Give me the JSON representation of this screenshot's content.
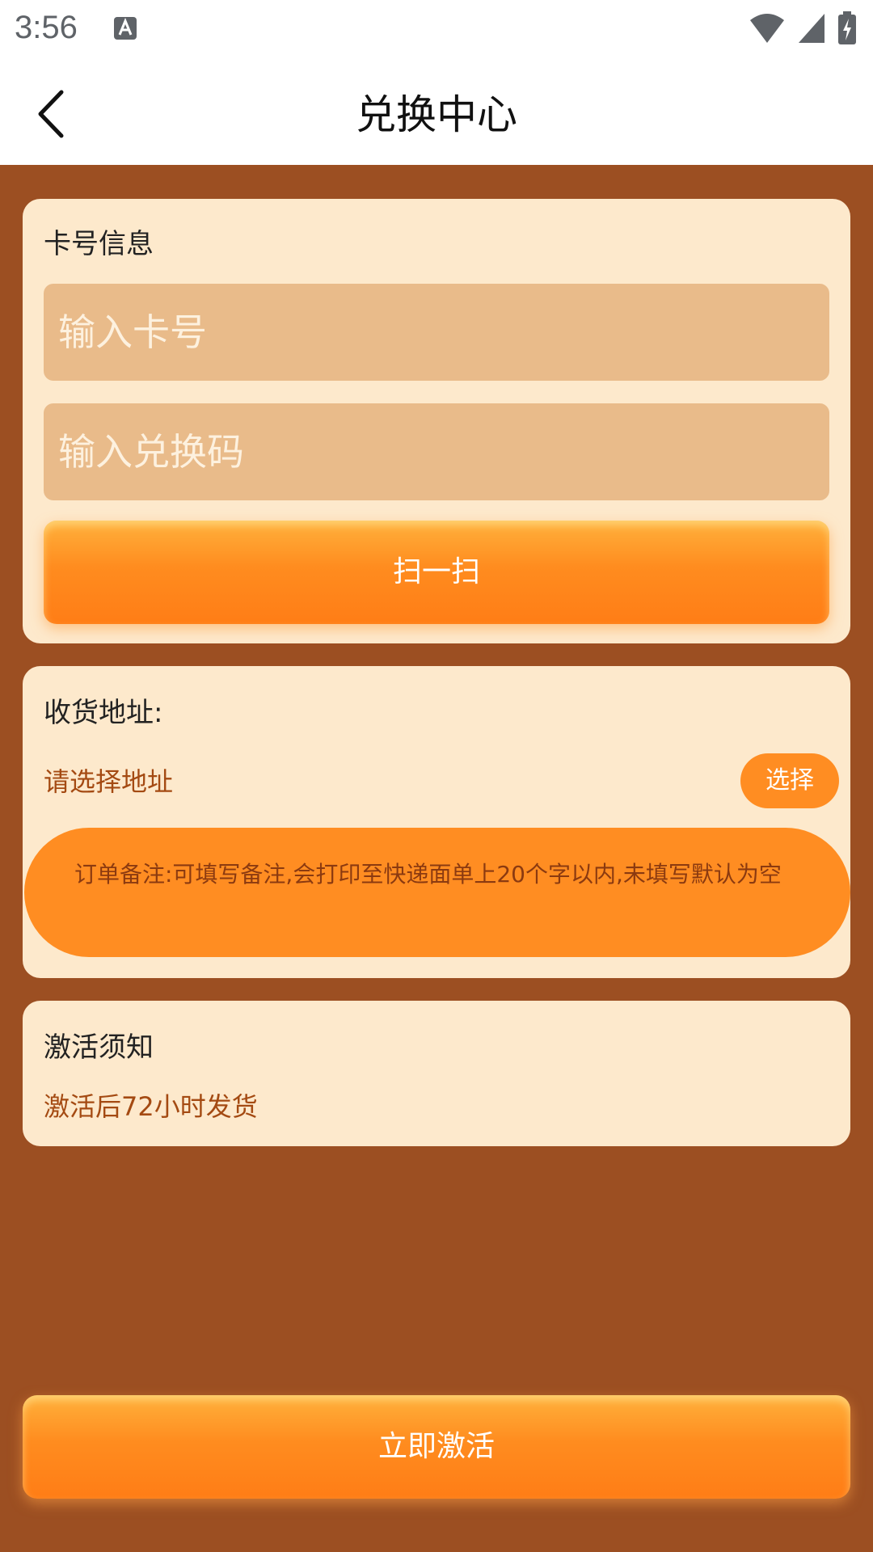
{
  "status_bar": {
    "time": "3:56",
    "icons": [
      "text-a-icon",
      "wifi-icon",
      "signal-icon",
      "battery-charging-icon"
    ]
  },
  "header": {
    "title": "兑换中心",
    "back_icon": "chevron-left-icon"
  },
  "card_info": {
    "heading": "卡号信息",
    "card_number_placeholder": "输入卡号",
    "card_number_value": "",
    "redeem_code_placeholder": "输入兑换码",
    "redeem_code_value": "",
    "scan_label": "扫一扫"
  },
  "address": {
    "heading": "收货地址:",
    "placeholder": "请选择地址",
    "select_label": "选择",
    "order_note": "订单备注:可填写备注,会打印至快递面单上20个字以内,未填写默认为空"
  },
  "notice": {
    "heading": "激活须知",
    "text": "激活后72小时发货"
  },
  "footer": {
    "activate_label": "立即激活"
  },
  "colors": {
    "page_background": "#9c4f22",
    "card_background": "#fde9cc",
    "input_background": "#e9bb8a",
    "accent_orange": "#ff8d22",
    "accent_text": "#a44a12"
  }
}
